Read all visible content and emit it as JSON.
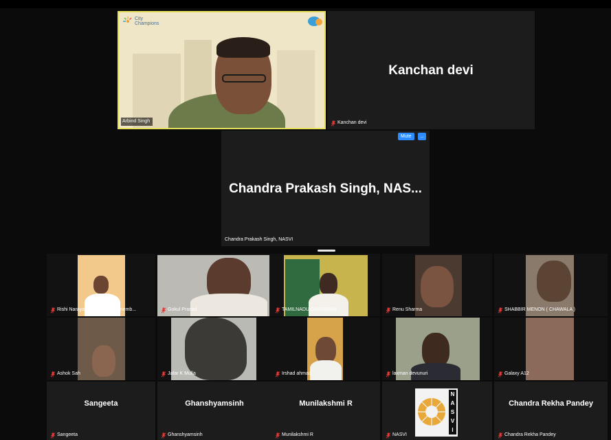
{
  "featured": {
    "arbind": {
      "name": "Arbind Singh",
      "logo_text": "City Champions",
      "logo_line1": "City",
      "logo_line2": "Champions"
    },
    "kanchan": {
      "title": "Kanchan devi",
      "name": "Kanchan devi"
    },
    "chandra": {
      "title": "Chandra Prakash Singh, NAS...",
      "name": "Chandra Prakash Singh, NASVI",
      "mute_label": "Mute",
      "more_label": "..."
    }
  },
  "grid_row1": [
    {
      "name": "Rishi Narayan varanasi E.C. memb..."
    },
    {
      "name": "Gokul Prasad"
    },
    {
      "name": "TAMILNADU CHAIRMAN"
    },
    {
      "name": "Renu Sharma"
    },
    {
      "name": "SHABBIR MENON ( CHAWALA )"
    }
  ],
  "grid_row2": [
    {
      "name": "Ashok Sah"
    },
    {
      "name": "Jafar K Mulla"
    },
    {
      "name": "Irshad ahmad"
    },
    {
      "name": "laxman devunuri"
    },
    {
      "name": "Galaxy A12"
    }
  ],
  "grid_row3": [
    {
      "title": "Sangeeta",
      "name": "Sangeeta"
    },
    {
      "title": "Ghanshyamsinh",
      "name": "Ghanshyamsinh"
    },
    {
      "title": "Munilakshmi R",
      "name": "Munilakshmi R"
    },
    {
      "name": "NASVI",
      "logo_letters": [
        "N",
        "A",
        "S",
        "V",
        "I"
      ]
    },
    {
      "title": "Chandra Rekha Pandey",
      "name": "Chandra Rekha Pandey"
    }
  ],
  "colors": {
    "muted_mic": "#e53935",
    "mute_button": "#2d8cff",
    "active_speaker_border": "#e6e05a"
  }
}
